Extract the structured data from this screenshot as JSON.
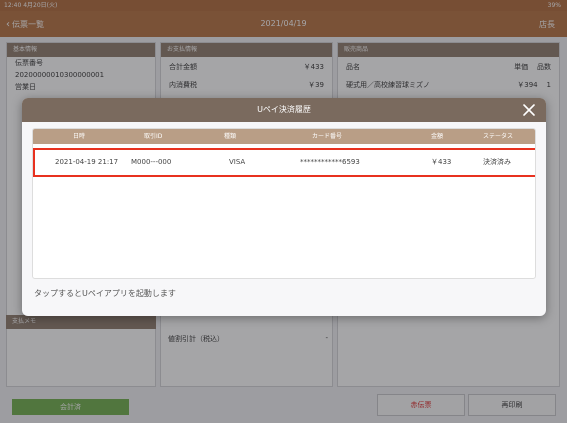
{
  "status_bar": {
    "time": "12:40",
    "date": "4月20日(火)",
    "battery": "39%"
  },
  "navbar": {
    "back_label": "伝票一覧",
    "date": "2021/04/19",
    "store_label": "店長"
  },
  "left_panel": {
    "header": "基本情報",
    "slip_label": "伝票番号",
    "slip_number": "20200000010300000001",
    "business_label": "営業日"
  },
  "mid_panel": {
    "header": "お支払情報",
    "total_label": "合計金額",
    "total_value": "￥433",
    "tax_label": "内消費税",
    "tax_value": "￥39",
    "discount_label": "値割引計（税込）",
    "discount_value": "-"
  },
  "right_panel": {
    "header": "販売商品",
    "col_name": "品名",
    "col_price": "単価",
    "col_qty": "品数",
    "item_name": "硬式用／高校練習球ミズノ",
    "item_price": "￥394",
    "item_qty": "1"
  },
  "memo_header": "支払メモ",
  "bottom": {
    "green_label": "会計済",
    "red_button": "赤伝票",
    "reprint_button": "再印刷"
  },
  "modal": {
    "title": "Uペイ決済履歴",
    "columns": {
      "date": "日時",
      "id": "取引ID",
      "brand": "種類",
      "card": "カード番号",
      "amount": "金額",
      "status": "ステータス"
    },
    "rows": [
      {
        "date": "2021-04-19 21:17",
        "id": "M000---000",
        "brand": "VISA",
        "card": "************6593",
        "amount": "￥433",
        "status": "決済済み"
      }
    ],
    "hint": "タップするとUペイアプリを起動します"
  },
  "colors": {
    "accent": "#b5703f",
    "highlight": "#e8311f",
    "table_header": "#b99e86"
  }
}
